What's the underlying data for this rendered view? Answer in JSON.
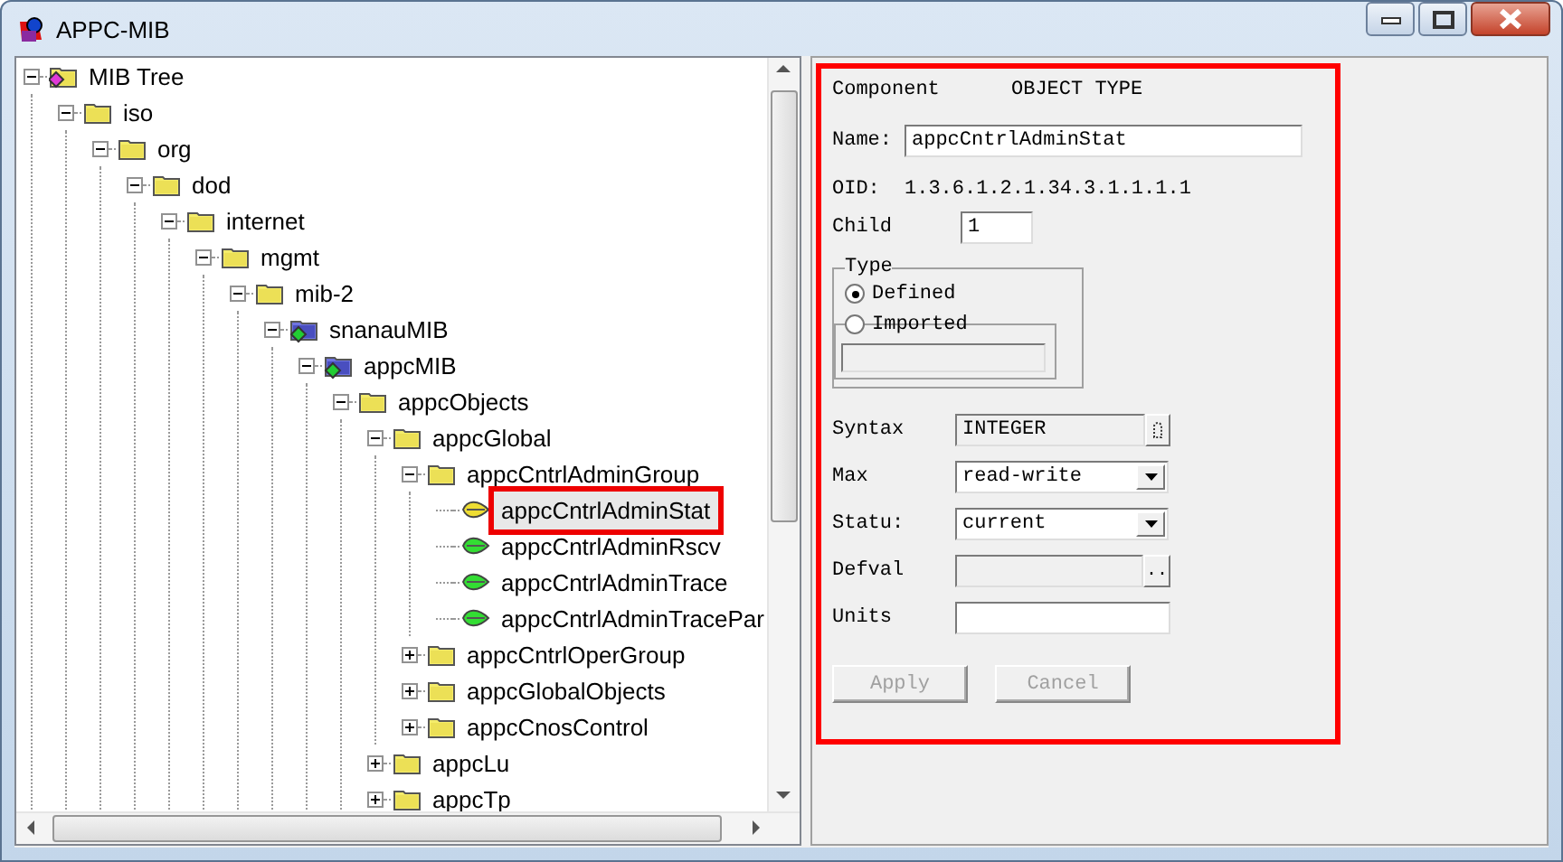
{
  "window": {
    "title": "APPC-MIB"
  },
  "tree": {
    "items": [
      {
        "label": "MIB Tree",
        "kind": "root",
        "expanded": true,
        "selected": false,
        "children": [
          {
            "label": "iso",
            "kind": "folder",
            "expanded": true,
            "selected": false,
            "children": [
              {
                "label": "org",
                "kind": "folder",
                "expanded": true,
                "selected": false,
                "children": [
                  {
                    "label": "dod",
                    "kind": "folder",
                    "expanded": true,
                    "selected": false,
                    "children": [
                      {
                        "label": "internet",
                        "kind": "folder",
                        "expanded": true,
                        "selected": false,
                        "children": [
                          {
                            "label": "mgmt",
                            "kind": "folder",
                            "expanded": true,
                            "selected": false,
                            "children": [
                              {
                                "label": "mib-2",
                                "kind": "folder",
                                "expanded": true,
                                "selected": false,
                                "children": [
                                  {
                                    "label": "snanauMIB",
                                    "kind": "module",
                                    "expanded": true,
                                    "selected": false,
                                    "children": [
                                      {
                                        "label": "appcMIB",
                                        "kind": "module",
                                        "expanded": true,
                                        "selected": false,
                                        "children": [
                                          {
                                            "label": "appcObjects",
                                            "kind": "folder",
                                            "expanded": true,
                                            "selected": false,
                                            "children": [
                                              {
                                                "label": "appcGlobal",
                                                "kind": "folder",
                                                "expanded": true,
                                                "selected": false,
                                                "children": [
                                                  {
                                                    "label": "appcCntrlAdminGroup",
                                                    "kind": "folder",
                                                    "expanded": true,
                                                    "selected": false,
                                                    "children": [
                                                      {
                                                        "label": "appcCntrlAdminStat",
                                                        "kind": "leaf",
                                                        "selected": true
                                                      },
                                                      {
                                                        "label": "appcCntrlAdminRscv",
                                                        "kind": "leaf",
                                                        "selected": false
                                                      },
                                                      {
                                                        "label": "appcCntrlAdminTrace",
                                                        "kind": "leaf",
                                                        "selected": false
                                                      },
                                                      {
                                                        "label": "appcCntrlAdminTracePar",
                                                        "kind": "leaf",
                                                        "selected": false
                                                      }
                                                    ]
                                                  },
                                                  {
                                                    "label": "appcCntrlOperGroup",
                                                    "kind": "folder",
                                                    "expanded": false,
                                                    "selected": false
                                                  },
                                                  {
                                                    "label": "appcGlobalObjects",
                                                    "kind": "folder",
                                                    "expanded": false,
                                                    "selected": false
                                                  },
                                                  {
                                                    "label": "appcCnosControl",
                                                    "kind": "folder",
                                                    "expanded": false,
                                                    "selected": false
                                                  }
                                                ]
                                              },
                                              {
                                                "label": "appcLu",
                                                "kind": "folder",
                                                "expanded": false,
                                                "selected": false
                                              },
                                              {
                                                "label": "appcTp",
                                                "kind": "folder",
                                                "expanded": false,
                                                "selected": false
                                              }
                                            ]
                                          }
                                        ]
                                      }
                                    ]
                                  }
                                ]
                              }
                            ]
                          }
                        ]
                      }
                    ]
                  }
                ]
              }
            ]
          }
        ]
      }
    ]
  },
  "details": {
    "highlighted": true,
    "component": {
      "label": "Component",
      "value": "OBJECT TYPE"
    },
    "name": {
      "label": "Name:",
      "value": "appcCntrlAdminStat"
    },
    "oid": {
      "label": "OID:",
      "value": "1.3.6.1.2.1.34.3.1.1.1.1"
    },
    "child": {
      "label": "Child",
      "value": "1"
    },
    "type_group": {
      "label": "Type",
      "options": [
        {
          "label": "Defined",
          "selected": true
        },
        {
          "label": "Imported",
          "selected": false
        }
      ]
    },
    "fields": [
      {
        "kind": "lookup",
        "label": "Syntax",
        "value": "INTEGER"
      },
      {
        "kind": "dropdown",
        "label": "Max",
        "value": "read-write"
      },
      {
        "kind": "dropdown",
        "label": "Statu:",
        "value": "current"
      },
      {
        "kind": "browse",
        "label": "Defval",
        "button": ".."
      },
      {
        "kind": "text",
        "label": "Units"
      }
    ],
    "buttons": [
      {
        "label": "Apply",
        "disabled": true
      },
      {
        "label": "Cancel",
        "disabled": true
      }
    ]
  }
}
